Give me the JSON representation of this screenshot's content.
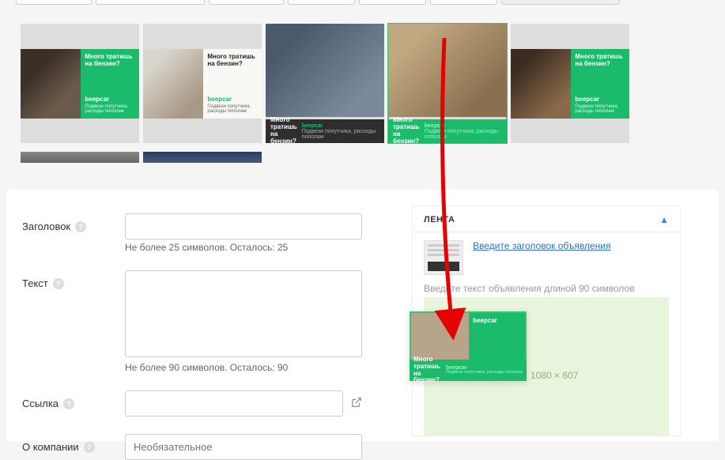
{
  "thumbs": {
    "title_ru": "Много тратишь на бензин?",
    "brand": "beepcar",
    "sub": "Подвези попутчика, расходы пополам"
  },
  "form": {
    "headline_label": "Заголовок",
    "headline_hint": "Не более 25 символов. Осталось: 25",
    "text_label": "Текст",
    "text_hint": "Не более 90 символов. Осталось: 90",
    "link_label": "Ссылка",
    "company_label": "О компании",
    "company_placeholder": "Необязательное"
  },
  "preview": {
    "tab_title": "ЛЕНТА",
    "headline_placeholder": "Введите заголовок объявления",
    "text_placeholder": "Введите текст объявления длиной 90 символов",
    "dimensions": "1080 × 607"
  }
}
